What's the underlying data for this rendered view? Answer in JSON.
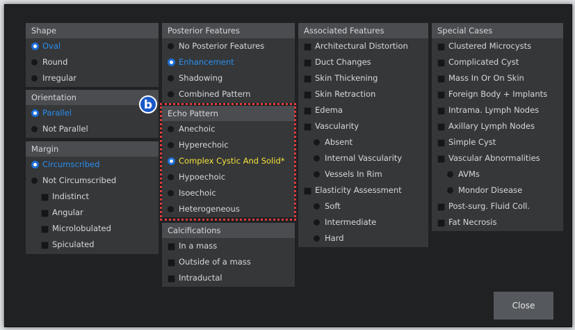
{
  "shape": {
    "title": "Shape",
    "options": [
      "Oval",
      "Round",
      "Irregular"
    ],
    "selected": 0
  },
  "orientation": {
    "title": "Orientation",
    "options": [
      "Parallel",
      "Not Parallel"
    ],
    "selected": 0
  },
  "margin": {
    "title": "Margin",
    "options": [
      "Circumscribed",
      "Not Circumscribed"
    ],
    "sub_options": [
      "Indistinct",
      "Angular",
      "Microlobulated",
      "Spiculated"
    ],
    "selected": 0
  },
  "posterior": {
    "title": "Posterior Features",
    "options": [
      "No Posterior Features",
      "Enhancement",
      "Shadowing",
      "Combined Pattern"
    ],
    "selected": 1
  },
  "echo": {
    "title": "Echo Pattern",
    "options": [
      "Anechoic",
      "Hyperechoic",
      "Complex Cystic And Solid*",
      "Hypoechoic",
      "Isoechoic",
      "Heterogeneous"
    ],
    "selected": 2,
    "badge": "b",
    "highlight_color": "#e23b3b"
  },
  "calcifications": {
    "title": "Calcifications",
    "options": [
      "In a mass",
      "Outside of a mass",
      "Intraductal"
    ]
  },
  "associated": {
    "title": "Associated Features",
    "items": [
      "Architectural Distortion",
      "Duct Changes",
      "Skin Thickening",
      "Skin Retraction",
      "Edema",
      "Vascularity"
    ],
    "vascularity_options": [
      "Absent",
      "Internal Vascularity",
      "Vessels In Rim"
    ],
    "elasticity": "Elasticity Assessment",
    "elasticity_options": [
      "Soft",
      "Intermediate",
      "Hard"
    ]
  },
  "special": {
    "title": "Special Cases",
    "items": [
      "Clustered Microcysts",
      "Complicated Cyst",
      "Mass In Or On Skin",
      "Foreign Body + Implants",
      "Intrama. Lymph Nodes",
      "Axillary Lymph Nodes",
      "Simple Cyst",
      "Vascular Abnormalities"
    ],
    "vascular_options": [
      "AVMs",
      "Mondor Disease"
    ],
    "items_after": [
      "Post-surg. Fluid Coll.",
      "Fat Necrosis"
    ]
  },
  "close_label": "Close",
  "colors": {
    "selected_text": "#2a8ff0",
    "highlight_text": "#f5e23a",
    "accent": "#1d6fd8"
  }
}
